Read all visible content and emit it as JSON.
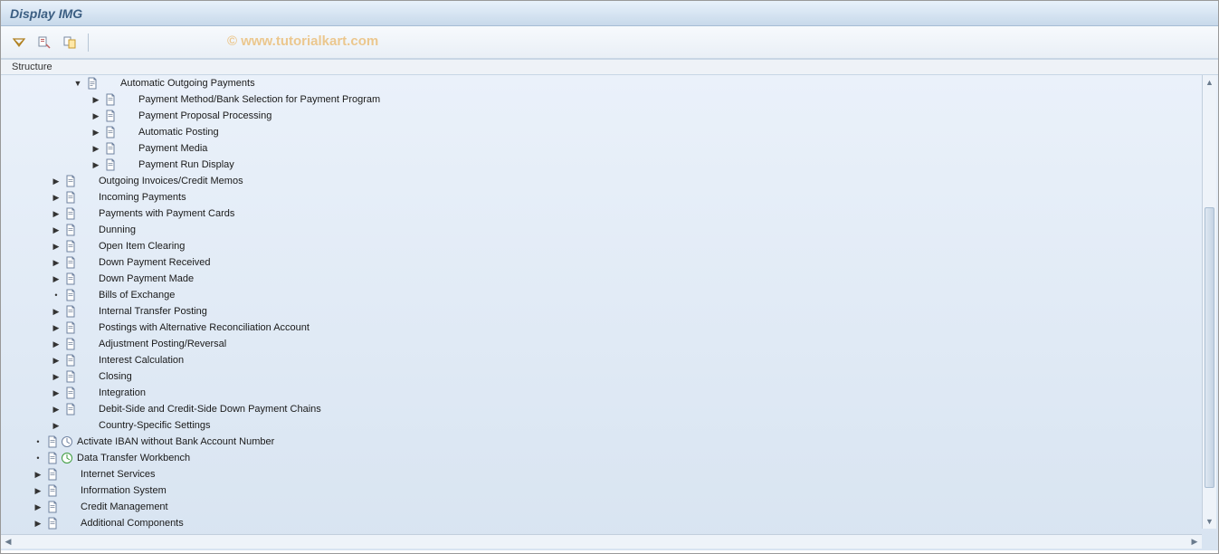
{
  "window": {
    "title": "Display IMG"
  },
  "watermark": "© www.tutorialkart.com",
  "structure_header": "Structure",
  "tree": {
    "top": {
      "label": "Automatic Outgoing Payments",
      "children": [
        {
          "label": "Payment Method/Bank Selection for Payment Program"
        },
        {
          "label": "Payment Proposal Processing"
        },
        {
          "label": "Automatic Posting"
        },
        {
          "label": "Payment Media"
        },
        {
          "label": "Payment Run Display"
        }
      ]
    },
    "middle": [
      {
        "label": "Outgoing Invoices/Credit Memos"
      },
      {
        "label": "Incoming Payments"
      },
      {
        "label": "Payments with Payment Cards"
      },
      {
        "label": "Dunning"
      },
      {
        "label": "Open Item Clearing"
      },
      {
        "label": "Down Payment Received"
      },
      {
        "label": "Down Payment Made"
      },
      {
        "label": "Bills of Exchange"
      },
      {
        "label": "Internal Transfer Posting"
      },
      {
        "label": "Postings with Alternative Reconciliation Account"
      },
      {
        "label": "Adjustment Posting/Reversal"
      },
      {
        "label": "Interest Calculation"
      },
      {
        "label": "Closing"
      },
      {
        "label": "Integration"
      },
      {
        "label": "Debit-Side and Credit-Side Down Payment Chains"
      },
      {
        "label": "Country-Specific Settings"
      }
    ],
    "bottom": [
      {
        "label": "Activate IBAN without Bank Account Number",
        "has_activity": true,
        "leaf": true
      },
      {
        "label": "Data Transfer Workbench",
        "has_activity": true,
        "leaf": true
      },
      {
        "label": "Internet Services"
      },
      {
        "label": "Information System"
      },
      {
        "label": "Credit Management"
      },
      {
        "label": "Additional Components"
      }
    ]
  }
}
